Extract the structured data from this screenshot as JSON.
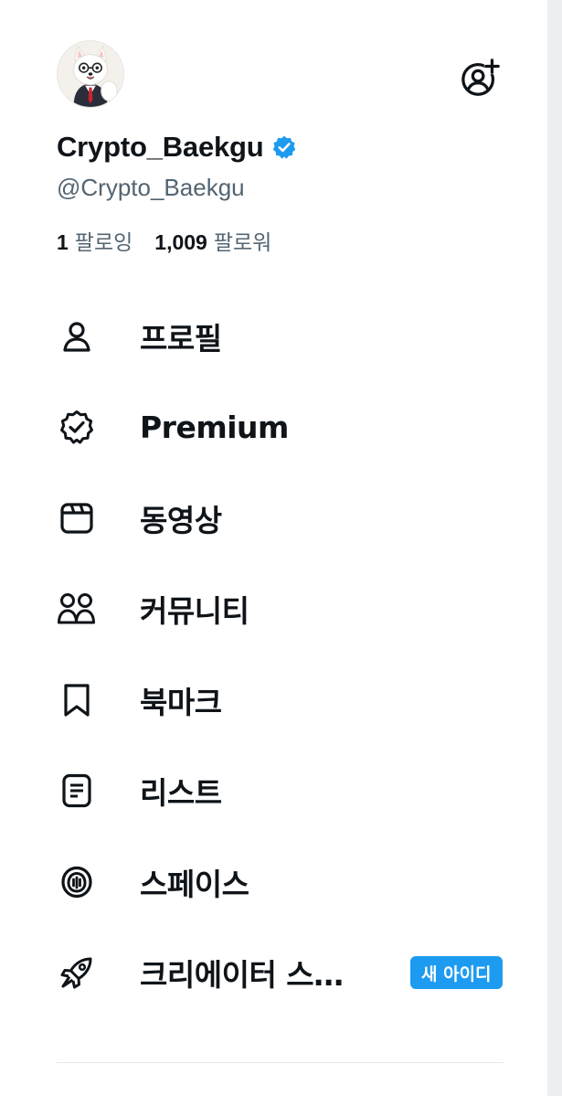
{
  "profile": {
    "display_name": "Crypto_Baekgu",
    "handle": "@Crypto_Baekgu",
    "verified": true,
    "following_count": "1",
    "following_label": "팔로잉",
    "followers_count": "1,009",
    "followers_label": "팔로워"
  },
  "colors": {
    "text": "#0f1419",
    "secondary_text": "#536471",
    "accent": "#1d9bf0",
    "divider": "#e5e8eb"
  },
  "menu": {
    "items": [
      {
        "label": "프로필",
        "icon": "person-icon"
      },
      {
        "label": "Premium",
        "icon": "verified-badge-icon"
      },
      {
        "label": "동영상",
        "icon": "video-icon"
      },
      {
        "label": "커뮤니티",
        "icon": "communities-icon"
      },
      {
        "label": "북마크",
        "icon": "bookmark-icon"
      },
      {
        "label": "리스트",
        "icon": "list-icon"
      },
      {
        "label": "스페이스",
        "icon": "spaces-icon"
      },
      {
        "label": "크리에이터 스…",
        "icon": "rocket-icon",
        "badge": "새 아이디"
      }
    ]
  }
}
